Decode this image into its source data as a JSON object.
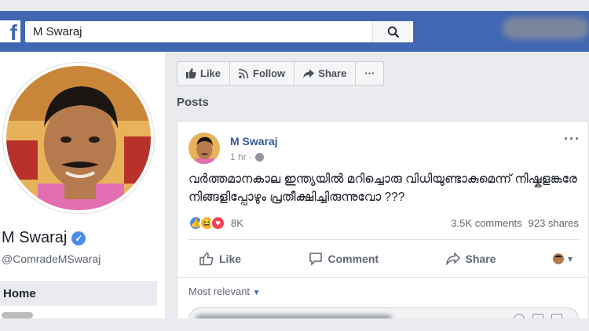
{
  "search": {
    "value": "M Swaraj",
    "logo": "f"
  },
  "profile": {
    "name": "M Swaraj",
    "handle": "@ComradeMSwaraj",
    "nav_home": "Home"
  },
  "actions": {
    "like": "Like",
    "follow": "Follow",
    "share": "Share",
    "more": "···"
  },
  "posts_heading": "Posts",
  "post": {
    "author": "M Swaraj",
    "time": "1 hr ·",
    "text": "വർത്തമാനകാല ഇന്ത്യയിൽ മറിച്ചൊരു വിധിയുണ്ടാകുമെന്ന് നിഷ്കളങ്കരേ നിങ്ങളിപ്പോഴും പ്രതീക്ഷിച്ചിരുന്നുവോ ???",
    "reaction_count": "8K",
    "comments": "3.5K comments",
    "shares": "923 shares",
    "more": "···",
    "like_label": "Like",
    "comment_label": "Comment",
    "share_label": "Share"
  },
  "comments": {
    "sort_label": "Most relevant"
  },
  "colors": {
    "brand": "#4267b2",
    "link": "#365899",
    "like_blue": "#4b8ce8",
    "love_red": "#f33e58",
    "haha_yellow": "#f7b125"
  }
}
